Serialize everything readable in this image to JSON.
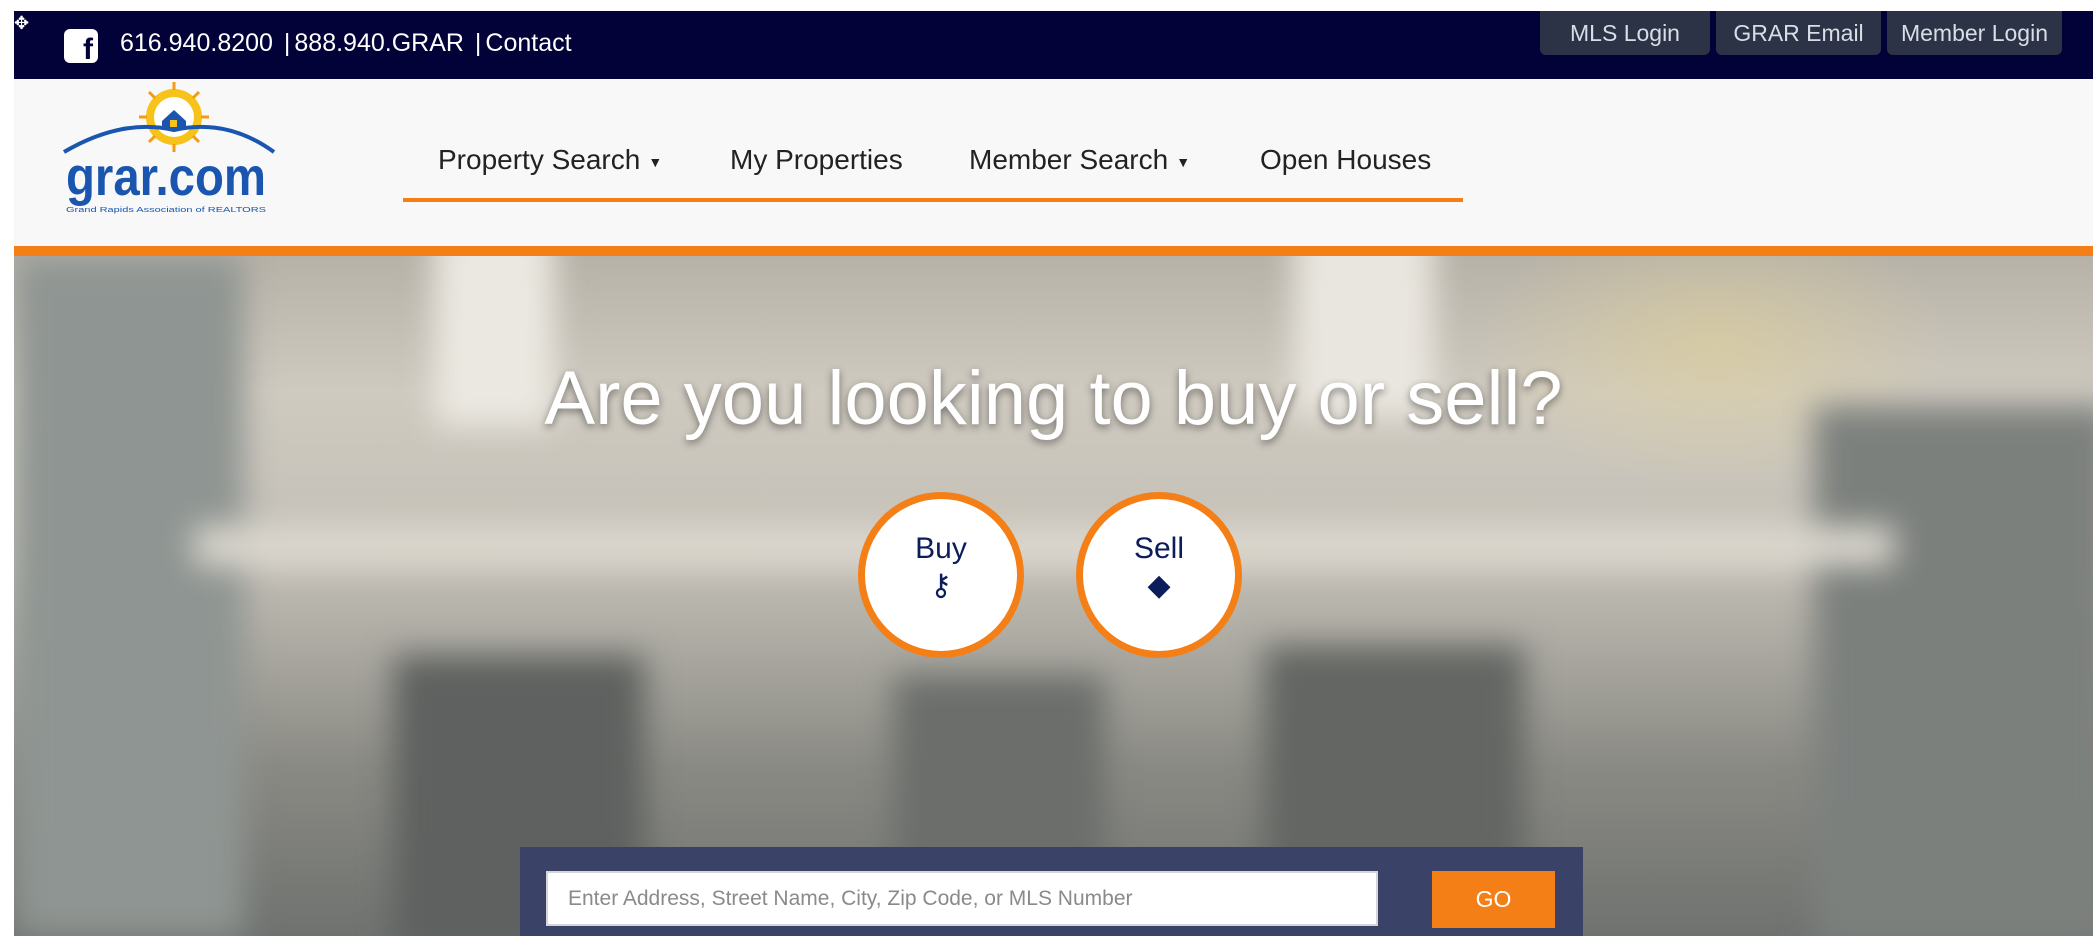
{
  "topbar": {
    "facebook_icon": "facebook-icon",
    "phone_local": "616.940.8200",
    "phone_tollfree": "888.940.GRAR",
    "separator": "|",
    "contact_label": "Contact",
    "mls_login": "MLS Login",
    "grar_email": "GRAR Email",
    "member_login": "Member Login"
  },
  "logo": {
    "name": "grar.com",
    "tagline": "Grand Rapids Association of REALTORS"
  },
  "nav": {
    "items": [
      {
        "label": "Property Search",
        "caret": "▼"
      },
      {
        "label": "My Properties"
      },
      {
        "label": "Member Search",
        "caret": "▼"
      },
      {
        "label": "Open Houses"
      }
    ]
  },
  "hero": {
    "title": "Are you looking to buy or sell?",
    "buy_label": "Buy",
    "buy_icon": "key-icon",
    "sell_label": "Sell",
    "sell_icon": "tag-icon"
  },
  "search": {
    "placeholder": "Enter Address, Street Name, City, Zip Code, or MLS Number",
    "go_label": "GO"
  },
  "colors": {
    "topbar": "#030238",
    "accent": "#f57f17",
    "navy_text": "#0b1d5a",
    "search_panel": "#3b4268"
  }
}
